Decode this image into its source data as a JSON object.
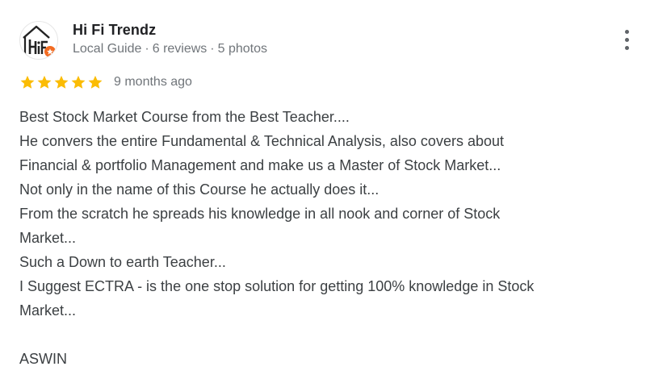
{
  "author": {
    "name": "Hi Fi Trendz",
    "avatar_text": "HiFi",
    "meta": {
      "badge": "Local Guide",
      "reviews": "6 reviews",
      "photos": "5 photos",
      "separator": "·"
    }
  },
  "more_menu_icon": "more-vert-icon",
  "rating": {
    "stars": 5,
    "max_stars": 5,
    "star_color": "#fbbc04",
    "date": "9 months ago"
  },
  "review": {
    "lines": [
      "Best Stock Market Course from the Best Teacher....",
      "He convers the entire Fundamental & Technical Analysis, also covers about",
      "Financial & portfolio Management and make us a Master of Stock Market...",
      "Not only in the name of this Course he actually does it...",
      "From the scratch he spreads his knowledge in all nook and corner of Stock",
      "Market...",
      "Such a Down to earth Teacher...",
      "I Suggest ECTRA - is the one stop solution for getting 100% knowledge in Stock",
      "Market...",
      "",
      "ASWIN"
    ]
  },
  "colors": {
    "name": "#202124",
    "meta": "#70757a",
    "body_text": "#3c4043",
    "logo_orange": "#f26b21"
  }
}
